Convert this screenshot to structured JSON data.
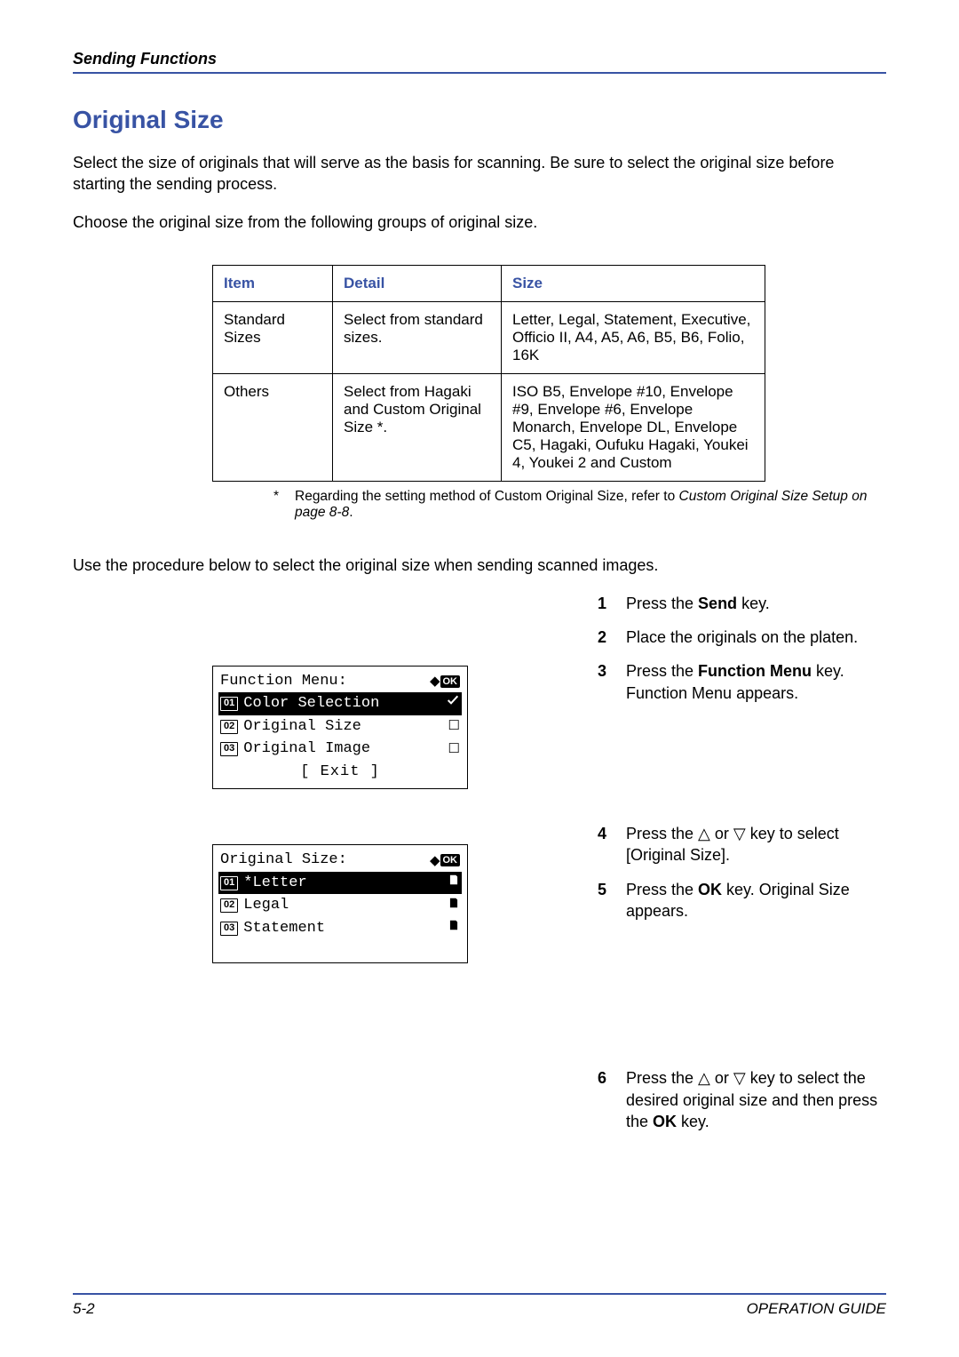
{
  "header": {
    "section": "Sending Functions"
  },
  "title": "Original Size",
  "intro1": "Select the size of originals that will serve as the basis for scanning. Be sure to select the original size before starting the sending process.",
  "intro2": "Choose the original size from the following groups of original size.",
  "table": {
    "headers": {
      "item": "Item",
      "detail": "Detail",
      "size": "Size"
    },
    "rows": [
      {
        "item": "Standard Sizes",
        "detail": "Select from standard sizes.",
        "size": "Letter, Legal, Statement, Executive, Officio II, A4, A5, A6, B5, B6, Folio, 16K"
      },
      {
        "item": "Others",
        "detail": "Select from Hagaki and Custom Original Size *.",
        "size": "ISO B5, Envelope #10, Envelope #9, Envelope #6, Envelope Monarch, Envelope DL, Envelope C5, Hagaki, Oufuku Hagaki, Youkei 4, Youkei 2 and Custom"
      }
    ]
  },
  "footnote": {
    "mark": "*",
    "text_plain": "Regarding the setting method of Custom Original Size, refer to ",
    "text_italic": "Custom Original Size Setup on page 8-8",
    "text_tail": "."
  },
  "lead2": "Use the procedure below to select the original size when sending scanned images.",
  "steps": {
    "s1": {
      "num": "1",
      "pre": "Press the ",
      "bold": "Send",
      "post": " key."
    },
    "s2": {
      "num": "2",
      "text": "Place the originals on the platen."
    },
    "s3": {
      "num": "3",
      "pre": "Press the ",
      "bold": "Function Menu",
      "post": " key. Function Menu appears."
    },
    "s4": {
      "num": "4",
      "text": "Press the △ or ▽ key to select [Original Size]."
    },
    "s5": {
      "num": "5",
      "pre": "Press the ",
      "bold": "OK",
      "post": " key. Original Size appears."
    },
    "s6": {
      "num": "6",
      "pre": "Press the △ or ▽ key to select the desired original size and then press the ",
      "bold": "OK",
      "post": " key."
    }
  },
  "lcd1": {
    "title": "Function Menu:",
    "ok": "OK",
    "rows": [
      {
        "n": "01",
        "label": "Color Selection",
        "selected": true,
        "end": "check"
      },
      {
        "n": "02",
        "label": "Original Size",
        "selected": false,
        "end": "box"
      },
      {
        "n": "03",
        "label": "Original Image",
        "selected": false,
        "end": "box"
      }
    ],
    "exit": "[  Exit  ]"
  },
  "lcd2": {
    "title": "Original Size:",
    "ok": "OK",
    "rows": [
      {
        "n": "01",
        "label": "*Letter",
        "selected": true,
        "end": "page"
      },
      {
        "n": "02",
        "label": "Legal",
        "selected": false,
        "end": "page"
      },
      {
        "n": "03",
        "label": "Statement",
        "selected": false,
        "end": "page"
      }
    ]
  },
  "footer": {
    "page": "5-2",
    "guide": "OPERATION GUIDE"
  }
}
